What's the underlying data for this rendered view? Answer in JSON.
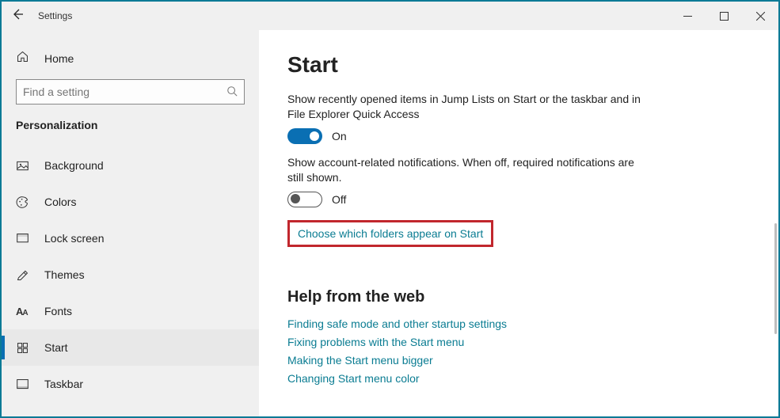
{
  "titlebar": {
    "title": "Settings"
  },
  "sidebar": {
    "home": "Home",
    "search_placeholder": "Find a setting",
    "category": "Personalization",
    "items": [
      {
        "label": "Background"
      },
      {
        "label": "Colors"
      },
      {
        "label": "Lock screen"
      },
      {
        "label": "Themes"
      },
      {
        "label": "Fonts"
      },
      {
        "label": "Start"
      },
      {
        "label": "Taskbar"
      }
    ]
  },
  "main": {
    "heading": "Start",
    "setting1_desc": "Show recently opened items in Jump Lists on Start or the taskbar and in File Explorer Quick Access",
    "setting1_state": "On",
    "setting2_desc": "Show account-related notifications. When off, required notifications are still shown.",
    "setting2_state": "Off",
    "choose_link": "Choose which folders appear on Start",
    "help_header": "Help from the web",
    "help_links": [
      "Finding safe mode and other startup settings",
      "Fixing problems with the Start menu",
      "Making the Start menu bigger",
      "Changing Start menu color"
    ]
  }
}
